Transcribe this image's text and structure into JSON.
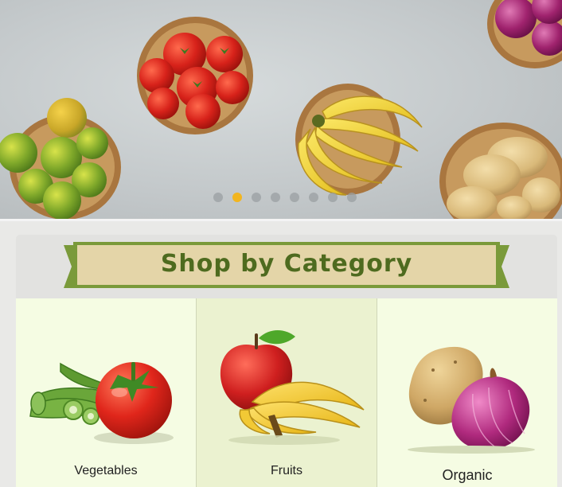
{
  "banner": {
    "slides_total": 8,
    "active_slide": 2
  },
  "section": {
    "title": "Shop by Category"
  },
  "categories": [
    {
      "label": "Vegetables",
      "icon": "vegetables-icon"
    },
    {
      "label": "Fruits",
      "icon": "fruits-icon"
    },
    {
      "label": "Organic",
      "icon": "organic-icon"
    }
  ],
  "colors": {
    "accent": "#f2b51f",
    "title": "#4e6b1f",
    "ribbon": "#e4d5a8",
    "ribbon_border": "#7a9a3a"
  }
}
